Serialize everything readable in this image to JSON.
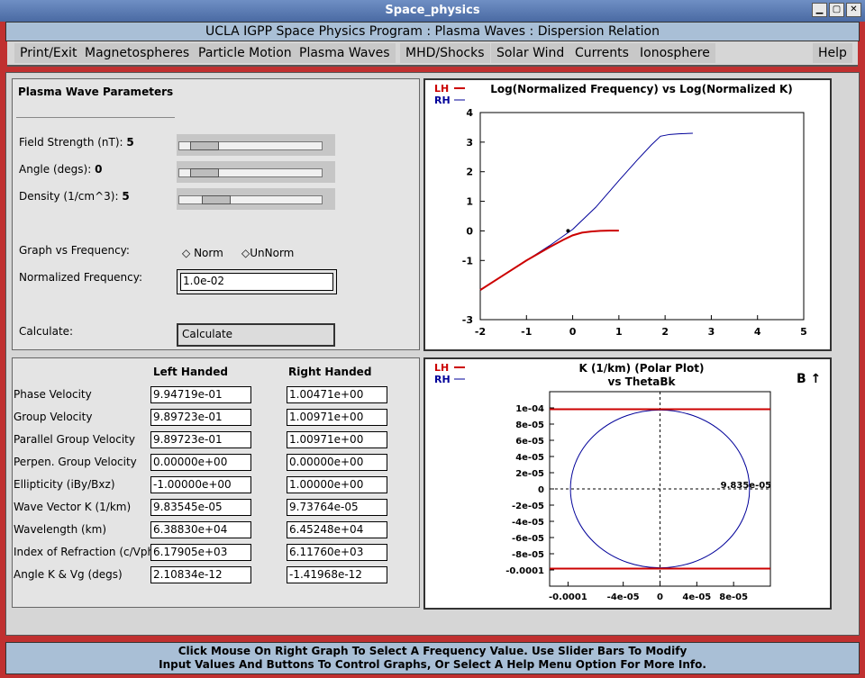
{
  "window": {
    "title": "Space_physics",
    "buttons": [
      "▁",
      "▢",
      "✕"
    ]
  },
  "header": {
    "title": "UCLA IGPP Space Physics Program : Plasma Waves : Dispersion Relation"
  },
  "menu": [
    {
      "label": "Print/Exit"
    },
    {
      "label": "Magnetospheres"
    },
    {
      "label": "Particle Motion"
    },
    {
      "label": "Plasma Waves"
    },
    {
      "label": "MHD/Shocks"
    },
    {
      "label": "Solar Wind"
    },
    {
      "label": "Currents"
    },
    {
      "label": "Ionosphere"
    },
    {
      "label": "Help"
    }
  ],
  "params": {
    "title": "Plasma Wave Parameters",
    "field_label": "Field Strength (nT):",
    "field_value": "5",
    "angle_label": "Angle (degs):",
    "angle_value": "0",
    "density_label": "Density (1/cm^3):",
    "density_value": "5",
    "graph_label": "Graph vs Frequency:",
    "norm_label": "Norm",
    "unnorm_label": "UnNorm",
    "nf_label": "Normalized Frequency:",
    "nf_value": "1.0e-02",
    "calc_label": "Calculate:",
    "calc_button": "Calculate",
    "sliders": [
      0.1,
      0.1,
      0.2
    ]
  },
  "output": {
    "col_left": "Left Handed",
    "col_right": "Right Handed",
    "rows": [
      {
        "label": "Phase Velocity",
        "left": "9.94719e-01",
        "right": "1.00471e+00"
      },
      {
        "label": "Group Velocity",
        "left": "9.89723e-01",
        "right": "1.00971e+00"
      },
      {
        "label": "Parallel Group Velocity",
        "left": "9.89723e-01",
        "right": "1.00971e+00"
      },
      {
        "label": "Perpen. Group Velocity",
        "left": "0.00000e+00",
        "right": "0.00000e+00"
      },
      {
        "label": "Ellipticity (iBy/Bxz)",
        "left": "-1.00000e+00",
        "right": "1.00000e+00"
      },
      {
        "label": "Wave Vector K (1/km)",
        "left": "9.83545e-05",
        "right": "9.73764e-05"
      },
      {
        "label": "Wavelength (km)",
        "left": "6.38830e+04",
        "right": "6.45248e+04"
      },
      {
        "label": "Index of Refraction (c/Vph)",
        "left": "6.17905e+03",
        "right": "6.11760e+03"
      },
      {
        "label": "Angle K & Vg (degs)",
        "left": "2.10834e-12",
        "right": "-1.41968e-12"
      }
    ]
  },
  "legend": {
    "lh": "LH",
    "rh": "RH",
    "lh_color": "#cc0000",
    "rh_color": "#000099"
  },
  "chart_data": [
    {
      "type": "line",
      "title": "Log(Normalized Frequency) vs Log(Normalized K)",
      "xlim": [
        -2,
        5
      ],
      "ylim": [
        -3,
        4
      ],
      "xticks": [
        -2,
        -1,
        0,
        1,
        2,
        3,
        4,
        5
      ],
      "yticks": [
        -3,
        -1,
        0,
        1,
        2,
        3,
        4
      ],
      "series": [
        {
          "name": "RH",
          "color": "#000099",
          "x": [
            -2,
            -1.5,
            -1,
            -0.5,
            0,
            0.5,
            1,
            1.4,
            1.7,
            1.9,
            2.1,
            2.3,
            2.6
          ],
          "y": [
            -2,
            -1.5,
            -1,
            -0.5,
            0.05,
            0.8,
            1.7,
            2.4,
            2.9,
            3.2,
            3.26,
            3.28,
            3.3
          ]
        },
        {
          "name": "LH",
          "color": "#cc0000",
          "x": [
            -2,
            -1.5,
            -1,
            -0.5,
            -0.2,
            0,
            0.2,
            0.4,
            0.6,
            0.8,
            1
          ],
          "y": [
            -2,
            -1.5,
            -1,
            -0.55,
            -0.3,
            -0.15,
            -0.06,
            -0.02,
            0,
            0.01,
            0.01
          ]
        }
      ],
      "marker": {
        "x": -0.1,
        "y": 0.0
      }
    },
    {
      "type": "scatter",
      "title": "K (1/km) (Polar Plot)",
      "subtitle": "vs ThetaBk",
      "bfield_label": "B ↑",
      "xlim": [
        -0.00012,
        0.00012
      ],
      "ylim": [
        -0.00012,
        0.00012
      ],
      "xticks": [
        "-0.0001",
        "-4e-05",
        "0",
        "4e-05",
        "8e-05"
      ],
      "xtick_vals": [
        -0.0001,
        -4e-05,
        0,
        4e-05,
        8e-05
      ],
      "yticks": [
        "1e-04",
        "8e-05",
        "6e-05",
        "4e-05",
        "2e-05",
        "0",
        "-2e-05",
        "-4e-05",
        "-6e-05",
        "-8e-05",
        "-0.0001"
      ],
      "ytick_vals": [
        0.0001,
        8e-05,
        6e-05,
        4e-05,
        2e-05,
        0,
        -2e-05,
        -4e-05,
        -6e-05,
        -8e-05,
        -0.0001
      ],
      "rh_radius": 9.73764e-05,
      "lh_y": 9.83545e-05,
      "annotation": "9.835e-05"
    }
  ],
  "status": {
    "line1": "Click Mouse On Right Graph To Select A Frequency Value. Use Slider Bars To Modify",
    "line2": "Input Values And Buttons To Control Graphs, Or Select A Help Menu Option For More Info."
  }
}
